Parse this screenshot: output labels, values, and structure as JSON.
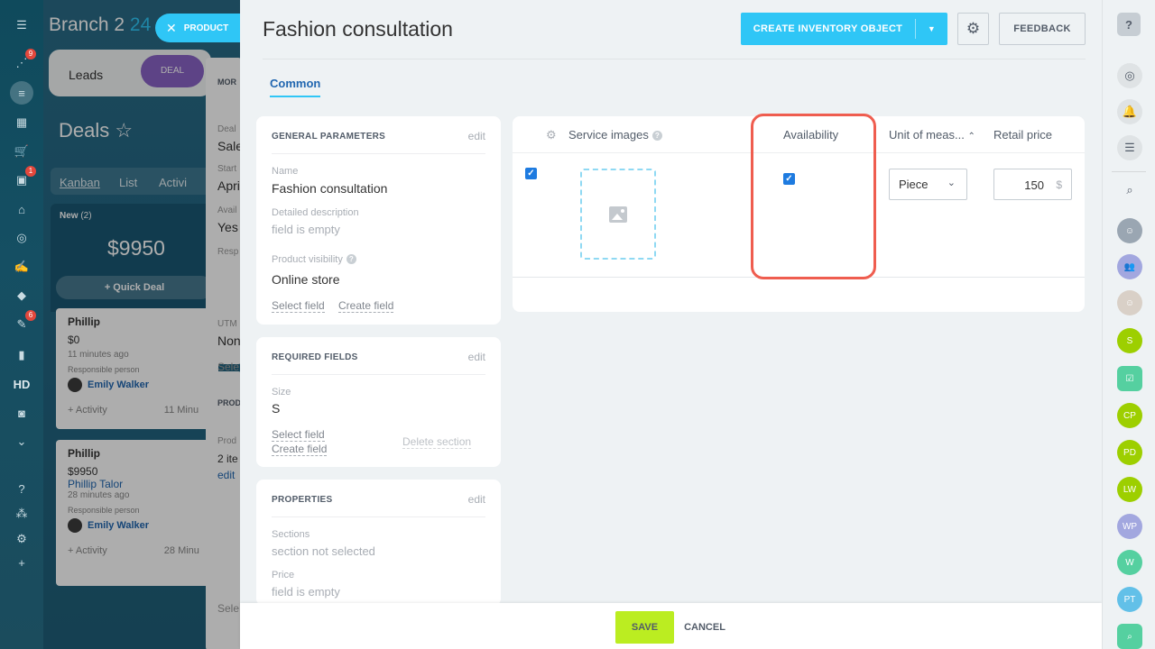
{
  "background": {
    "app_title": "Branch 2",
    "app_title_suffix": "24",
    "leads_tab": "Leads",
    "deal_tab": "DEAL",
    "deals_title": "Deals ☆",
    "view_tabs": [
      "Kanban",
      "List",
      "Activi"
    ],
    "column": {
      "title": "New",
      "count": "(2)",
      "sum": "$9950",
      "quick_deal": "+ Quick Deal"
    },
    "cards": [
      {
        "name": "Phillip",
        "amount": "$0",
        "time": "11 minutes ago",
        "resp_label": "Responsible person",
        "person": "Emily Walker",
        "activity": "+ Activity",
        "activity_time": "11 Minu"
      },
      {
        "name": "Phillip",
        "amount": "$9950",
        "contact": "Phillip Talor",
        "time": "28 minutes ago",
        "resp_label": "Responsible person",
        "person": "Emily Walker",
        "activity": "+ Activity",
        "activity_time": "28 Minu"
      }
    ],
    "mid_fragments": [
      "MOR",
      "Deal",
      "Sale",
      "Start",
      "Apri",
      "Avail",
      "Yes",
      "Resp",
      "UTM",
      "Non",
      "Sele",
      "PROD",
      "Prod",
      "2 ite",
      "edit",
      "Sele"
    ]
  },
  "left_nav": {
    "badges": [
      "9",
      "1",
      "6"
    ],
    "hd_label": "HD"
  },
  "product_chip": "PRODUCT",
  "panel": {
    "title": "Fashion consultation",
    "create_button": "CREATE INVENTORY OBJECT",
    "feedback_button": "FEEDBACK",
    "tab": "Common"
  },
  "general": {
    "title": "GENERAL PARAMETERS",
    "edit": "edit",
    "name_label": "Name",
    "name_value": "Fashion consultation",
    "desc_label": "Detailed description",
    "desc_value": "field is empty",
    "visibility_label": "Product visibility",
    "visibility_value": "Online store",
    "select_field": "Select field",
    "create_field": "Create field"
  },
  "required": {
    "title": "REQUIRED FIELDS",
    "edit": "edit",
    "size_label": "Size",
    "size_value": "S",
    "select_field": "Select field",
    "create_field": "Create field",
    "delete_section": "Delete section"
  },
  "properties": {
    "title": "PROPERTIES",
    "edit": "edit",
    "sections_label": "Sections",
    "sections_value": "section not selected",
    "price_label": "Price",
    "price_value": "field is empty"
  },
  "grid": {
    "columns": {
      "images": "Service images",
      "availability": "Availability",
      "unit": "Unit of meas...",
      "price": "Retail price"
    },
    "row": {
      "selected": true,
      "available": true,
      "unit": "Piece",
      "price": "150",
      "currency": "$"
    }
  },
  "footer": {
    "save": "SAVE",
    "cancel": "CANCEL"
  },
  "right_nav": {
    "help": "?",
    "avatars": [
      "S",
      "CP",
      "PD",
      "LW",
      "WP",
      "W",
      "PT"
    ],
    "avatar_colors": {
      "green": "#9dcf00",
      "green_hex": "#55d0a0",
      "blue": "#a2a7df",
      "light_blue": "#62c0e8"
    }
  }
}
